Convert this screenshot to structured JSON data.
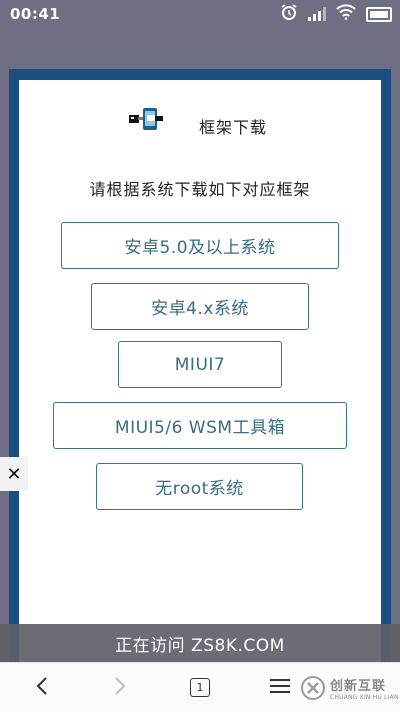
{
  "status_bar": {
    "time": "00:41",
    "icons": [
      "alarm-icon",
      "signal-icon",
      "wifi-icon",
      "battery-icon"
    ]
  },
  "dialog": {
    "title": "框架下载",
    "subtitle": "请根据系统下载如下对应框架",
    "buttons": [
      {
        "label": "安卓5.0及以上系统"
      },
      {
        "label": "安卓4.x系统"
      },
      {
        "label": "MIUI7"
      },
      {
        "label": "MIUI5/6 WSM工具箱"
      },
      {
        "label": "无root系统"
      }
    ]
  },
  "close": {
    "glyph": "✕"
  },
  "visit_bar": {
    "text": "正在访问 ZS8K.COM"
  },
  "navbar": {
    "back": "‹",
    "forward": "›",
    "tab_count": "1",
    "menu": "☰"
  },
  "watermark": {
    "main": "创新互联",
    "sub": "CHUANG XIN HU LIAN"
  },
  "colors": {
    "accent": "#3a6c82",
    "frame": "#1b4f83",
    "status_bg": "#6e6f83"
  }
}
